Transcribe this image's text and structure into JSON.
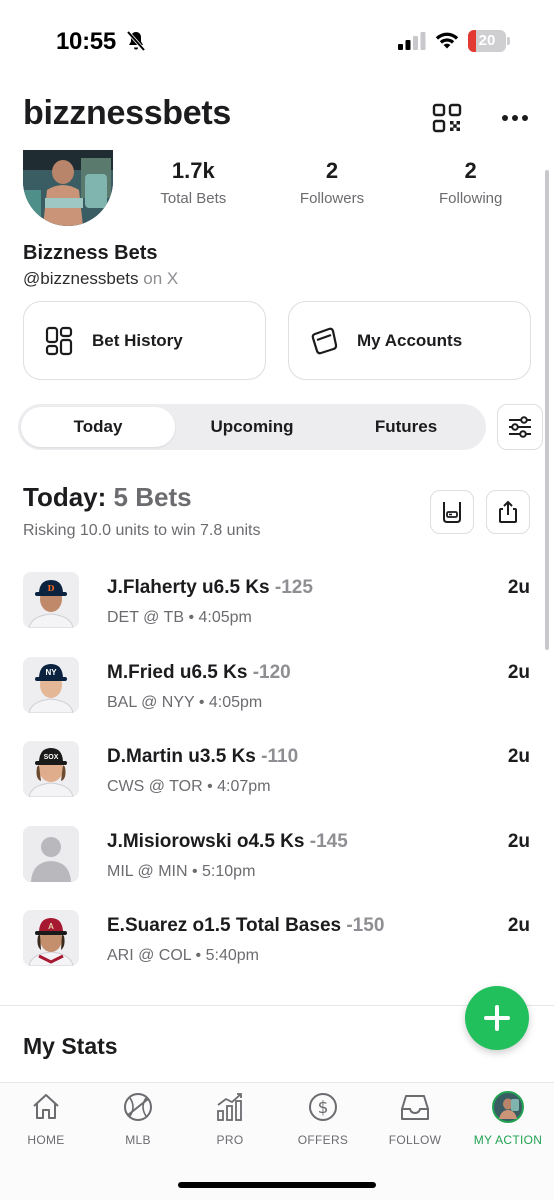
{
  "status_bar": {
    "time": "10:55",
    "battery": "20"
  },
  "header": {
    "username": "bizznessbets"
  },
  "profile": {
    "stats": [
      {
        "value": "1.7k",
        "label": "Total Bets"
      },
      {
        "value": "2",
        "label": "Followers"
      },
      {
        "value": "2",
        "label": "Following"
      }
    ],
    "display_name": "Bizzness Bets",
    "handle": "@bizznessbets",
    "handle_suffix": "on X"
  },
  "actions": {
    "bet_history": "Bet History",
    "my_accounts": "My Accounts"
  },
  "tabs": [
    {
      "label": "Today",
      "active": true
    },
    {
      "label": "Upcoming",
      "active": false
    },
    {
      "label": "Futures",
      "active": false
    }
  ],
  "today": {
    "title": "Today:",
    "count": "5 Bets",
    "risk_line": "Risking 10.0 units to win 7.8 units"
  },
  "bets": [
    {
      "pick": "J.Flaherty u6.5 Ks",
      "odds": "-125",
      "game": "DET @ TB • 4:05pm",
      "units": "2u",
      "team": "DET"
    },
    {
      "pick": "M.Fried u6.5 Ks",
      "odds": "-120",
      "game": "BAL @ NYY • 4:05pm",
      "units": "2u",
      "team": "NYY"
    },
    {
      "pick": "D.Martin u3.5 Ks",
      "odds": "-110",
      "game": "CWS @ TOR • 4:07pm",
      "units": "2u",
      "team": "CWS"
    },
    {
      "pick": "J.Misiorowski o4.5 Ks",
      "odds": "-145",
      "game": "MIL @ MIN • 5:10pm",
      "units": "2u",
      "team": "none"
    },
    {
      "pick": "E.Suarez o1.5 Total Bases",
      "odds": "-150",
      "game": "ARI @ COL • 5:40pm",
      "units": "2u",
      "team": "ARI"
    }
  ],
  "my_stats": {
    "title": "My Stats"
  },
  "tabbar": [
    {
      "label": "HOME",
      "icon": "home-icon"
    },
    {
      "label": "MLB",
      "icon": "baseball-icon"
    },
    {
      "label": "PRO",
      "icon": "chart-trend-icon"
    },
    {
      "label": "OFFERS",
      "icon": "dollar-circle-icon"
    },
    {
      "label": "FOLLOW",
      "icon": "inbox-icon"
    },
    {
      "label": "MY ACTION",
      "icon": "profile-avatar-icon",
      "active": true
    }
  ],
  "colors": {
    "accent_green": "#22c05c",
    "active_tab_green": "#22a352",
    "battery_low": "#e23a32"
  }
}
